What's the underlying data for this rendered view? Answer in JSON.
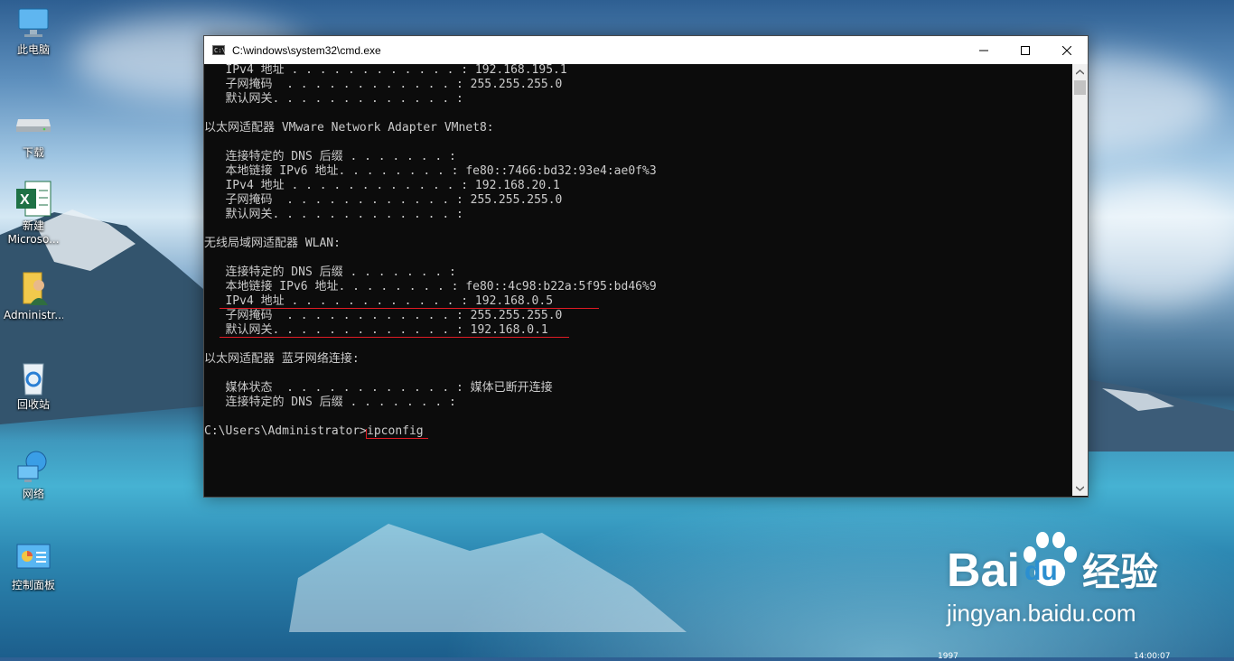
{
  "desktop": {
    "icons": [
      {
        "label": "此电脑",
        "icon": "this-pc-icon"
      },
      {
        "label": "下载",
        "icon": "downloads-icon"
      },
      {
        "label": "新建",
        "label2": "Microso...",
        "icon": "excel-file-icon"
      },
      {
        "label": "Administr...",
        "icon": "user-folder-icon"
      },
      {
        "label": "回收站",
        "icon": "recycle-bin-icon"
      },
      {
        "label": "网络",
        "icon": "network-icon"
      },
      {
        "label": "控制面板",
        "icon": "control-panel-icon"
      }
    ]
  },
  "cmd_window": {
    "title": "C:\\windows\\system32\\cmd.exe",
    "icon_text": "C:\\",
    "buttons": {
      "minimize": "minimize-icon",
      "maximize": "maximize-icon",
      "close": "close-icon"
    },
    "lines": [
      "   IPv4 地址 . . . . . . . . . . . . : 192.168.195.1",
      "   子网掩码  . . . . . . . . . . . . : 255.255.255.0",
      "   默认网关. . . . . . . . . . . . . :",
      "",
      "以太网适配器 VMware Network Adapter VMnet8:",
      "",
      "   连接特定的 DNS 后缀 . . . . . . . :",
      "   本地链接 IPv6 地址. . . . . . . . : fe80::7466:bd32:93e4:ae0f%3",
      "   IPv4 地址 . . . . . . . . . . . . : 192.168.20.1",
      "   子网掩码  . . . . . . . . . . . . : 255.255.255.0",
      "   默认网关. . . . . . . . . . . . . :",
      "",
      "无线局域网适配器 WLAN:",
      "",
      "   连接特定的 DNS 后缀 . . . . . . . :",
      "   本地链接 IPv6 地址. . . . . . . . : fe80::4c98:b22a:5f95:bd46%9",
      "   IPv4 地址 . . . . . . . . . . . . : 192.168.0.5",
      "   子网掩码  . . . . . . . . . . . . : 255.255.255.0",
      "   默认网关. . . . . . . . . . . . . : 192.168.0.1",
      "",
      "以太网适配器 蓝牙网络连接:",
      "",
      "   媒体状态  . . . . . . . . . . . . : 媒体已断开连接",
      "   连接特定的 DNS 后缀 . . . . . . . :",
      "",
      "C:\\Users\\Administrator>ipconfig"
    ],
    "prompt": "C:\\Users\\Administrator>",
    "command": "ipconfig",
    "highlight_color": "#e01b24"
  },
  "watermark": {
    "brand_left": "Bai",
    "brand_right": "du",
    "brand_cn": "经验",
    "url": "jingyan.baidu.com"
  },
  "taskbar_peek": {
    "left": "1997",
    "right": "14:00:07"
  }
}
